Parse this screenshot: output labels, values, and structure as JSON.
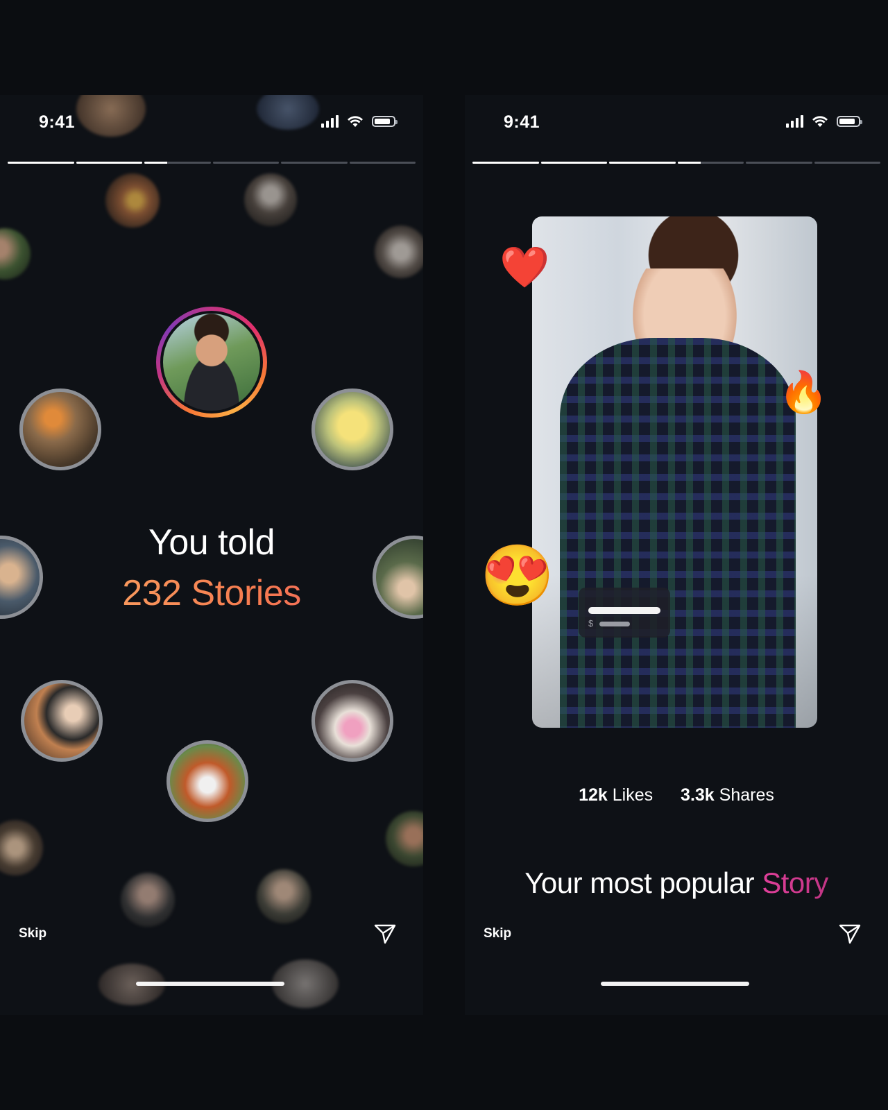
{
  "left_screen": {
    "status_time": "9:41",
    "progress_segments": [
      1,
      1,
      0.35,
      0,
      0,
      0
    ],
    "headline_line1": "You told",
    "headline_line2": "232 Stories",
    "skip_label": "Skip"
  },
  "right_screen": {
    "status_time": "9:41",
    "progress_segments": [
      1,
      1,
      1,
      0.35,
      0,
      0
    ],
    "likes_value": "12k",
    "likes_label": "Likes",
    "shares_value": "3.3k",
    "shares_label": "Shares",
    "title_prefix": "Your most popular",
    "title_accent": "Story",
    "price_symbol": "$",
    "skip_label": "Skip",
    "reactions": [
      "❤️",
      "🔥",
      "😍"
    ]
  },
  "colors": {
    "background": "#0b0d11",
    "gradient_orange": "#f67b4f",
    "accent_pink": "#e0409a"
  },
  "icons": [
    "signal-icon",
    "wifi-icon",
    "battery-icon",
    "send-icon"
  ]
}
